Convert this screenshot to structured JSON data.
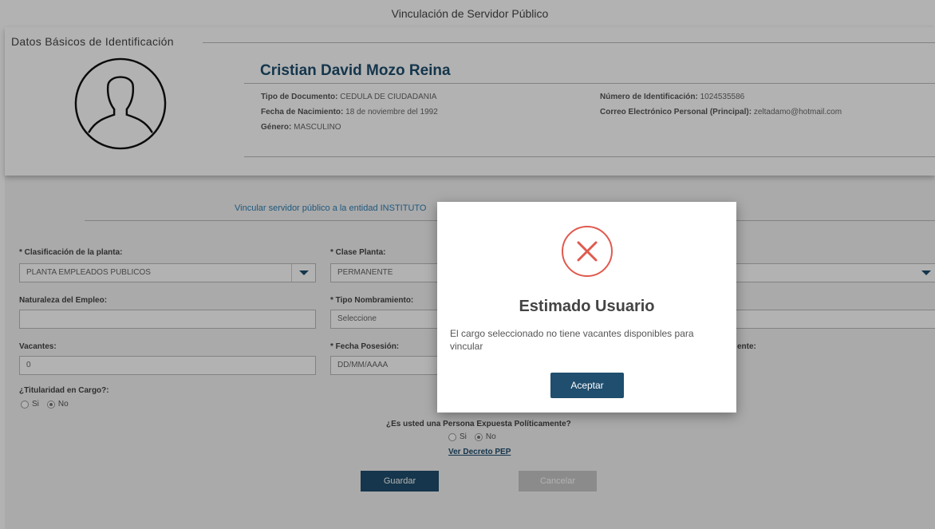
{
  "page_title": "Vinculación de Servidor Público",
  "section_title": "Datos Básicos de Identificación",
  "person": {
    "name": "Cristian David Mozo Reina",
    "doc_type_label": "Tipo de Documento:",
    "doc_type": "CEDULA DE CIUDADANIA",
    "birth_label": "Fecha de Nacimiento:",
    "birth": "18 de noviembre del 1992",
    "gender_label": "Género:",
    "gender": "MASCULINO",
    "id_label": "Número de Identificación:",
    "id": "1024535586",
    "email_label": "Correo Electrónico Personal (Principal):",
    "email": "zeltadamo@hotmail.com"
  },
  "link_text": "Vincular servidor público a la entidad INSTITUTO",
  "form": {
    "clasificacion_label": "* Clasificación de la planta:",
    "clasificacion_value": "PLANTA EMPLEADOS PUBLICOS",
    "clase_label": "* Clase Planta:",
    "clase_value": "PERMANENTE",
    "naturaleza_label": "Naturaleza del Empleo:",
    "naturaleza_value": "",
    "tipo_nombramiento_label": "* Tipo Nombramiento:",
    "tipo_nombramiento_value": "Seleccione",
    "vacantes_label": "Vacantes:",
    "vacantes_value": "0",
    "fecha_posesion_label": "* Fecha Posesión:",
    "fecha_posesion_placeholder": "DD/MM/AAAA",
    "truncated_label": "ente:",
    "titularidad_label": "¿Titularidad en Cargo?:",
    "option_si": "Si",
    "option_no": "No",
    "pep_question": "¿Es usted una Persona Expuesta Políticamente?",
    "pep_link": "Ver Decreto PEP"
  },
  "buttons": {
    "save": "Guardar",
    "cancel": "Cancelar"
  },
  "modal": {
    "title": "Estimado Usuario",
    "message": "El cargo seleccionado no tiene vacantes disponibles para vincular",
    "accept": "Aceptar",
    "icon": "error-x-circle-icon",
    "icon_color": "#e05a4e"
  },
  "colors": {
    "primary": "#1f4e6e",
    "link": "#2f7fb3",
    "disabled": "#c7c7c7"
  }
}
